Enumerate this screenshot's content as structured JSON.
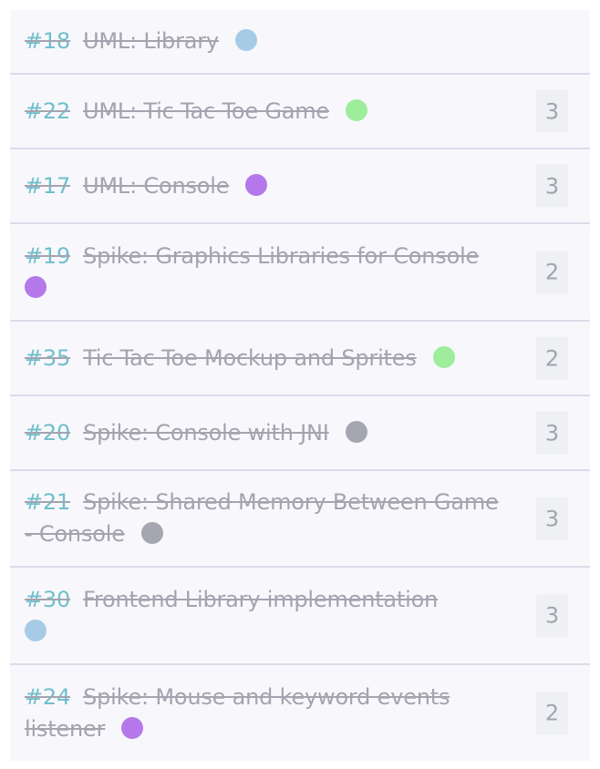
{
  "issues": [
    {
      "number": "#18",
      "title": "UML: Library",
      "label_color": "#a6cbe6",
      "points": null
    },
    {
      "number": "#22",
      "title": "UML: Tic Tac Toe Game",
      "label_color": "#9ded9b",
      "points": "3"
    },
    {
      "number": "#17",
      "title": "UML: Console",
      "label_color": "#b478ea",
      "points": "3"
    },
    {
      "number": "#19",
      "title": "Spike: Graphics Libraries for Console",
      "label_color": "#b478ea",
      "points": "2"
    },
    {
      "number": "#35",
      "title": "Tic Tac Toe Mockup and Sprites",
      "label_color": "#9ded9b",
      "points": "2"
    },
    {
      "number": "#20",
      "title": "Spike: Console with JNI",
      "label_color": "#a5a6af",
      "points": "3"
    },
    {
      "number": "#21",
      "title": "Spike: Shared Memory Between Game - Console",
      "label_color": "#a5a6af",
      "points": "3"
    },
    {
      "number": "#30",
      "title": "Frontend Library implementation",
      "label_color": "#a6cbe6",
      "points": "3"
    },
    {
      "number": "#24",
      "title": "Spike: Mouse and keyword events listener",
      "label_color": "#b478ea",
      "points": "2"
    }
  ]
}
